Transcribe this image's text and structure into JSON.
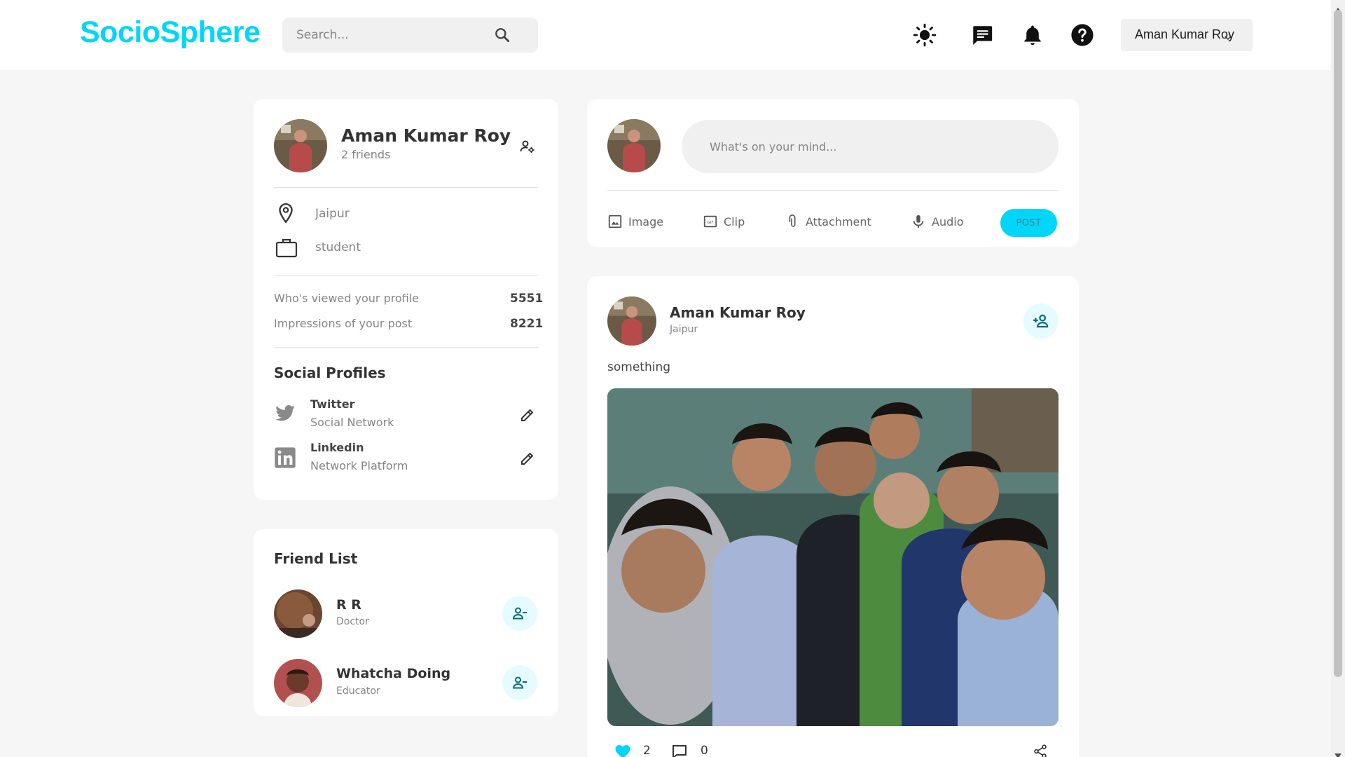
{
  "app": {
    "logo": "SocioSphere"
  },
  "navbar": {
    "search_placeholder": "Search...",
    "user_name": "Aman Kumar Roy",
    "icons": [
      "light-mode-icon",
      "message-icon",
      "notification-icon",
      "help-icon"
    ]
  },
  "profile": {
    "name": "Aman Kumar Roy",
    "friends": "2 friends",
    "location": "Jaipur",
    "occupation": "student",
    "stats": [
      {
        "label": "Who's viewed your profile",
        "value": "5551"
      },
      {
        "label": "Impressions of your post",
        "value": "8221"
      }
    ],
    "social_title": "Social Profiles",
    "socials": [
      {
        "name": "Twitter",
        "sub": "Social Network"
      },
      {
        "name": "Linkedin",
        "sub": "Network Platform"
      }
    ]
  },
  "friends": {
    "title": "Friend List",
    "items": [
      {
        "name": "R R",
        "sub": "Doctor"
      },
      {
        "name": "Whatcha Doing",
        "sub": "Educator"
      }
    ]
  },
  "composer": {
    "placeholder": "What's on your mind...",
    "tools": [
      "Image",
      "Clip",
      "Attachment",
      "Audio"
    ],
    "post_label": "POST"
  },
  "post": {
    "author": "Aman Kumar Roy",
    "location": "Jaipur",
    "text": "something",
    "likes": "2",
    "comments": "0"
  },
  "colors": {
    "brand": "#00d5fa",
    "background": "#f6f6f6",
    "card": "#ffffff",
    "accent_light": "#e6fbff"
  }
}
